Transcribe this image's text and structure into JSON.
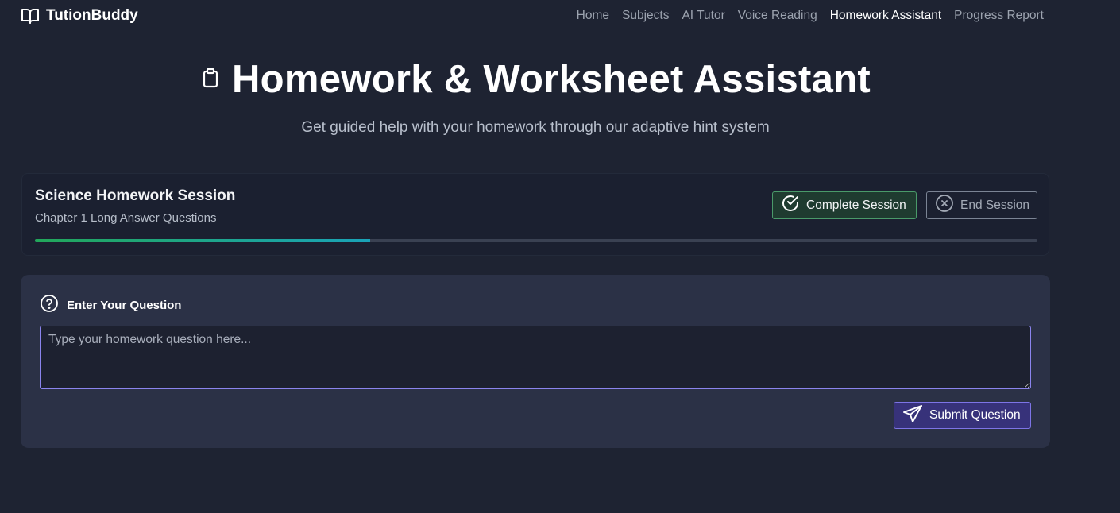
{
  "colors": {
    "background": "#1e2332",
    "card": "#2b3146",
    "accent": "#7d74e6",
    "success": "#4a9a6a"
  },
  "nav": {
    "brand": "TutionBuddy",
    "brand_icon": "open-book-icon",
    "links": [
      {
        "label": "Home",
        "active": false
      },
      {
        "label": "Subjects",
        "active": false
      },
      {
        "label": "AI Tutor",
        "active": false
      },
      {
        "label": "Voice Reading",
        "active": false
      },
      {
        "label": "Homework Assistant",
        "active": true
      },
      {
        "label": "Progress Report",
        "active": false
      }
    ]
  },
  "hero": {
    "icon": "clipboard-icon",
    "title": "Homework & Worksheet Assistant",
    "subtitle": "Get guided help with your homework through our adaptive hint system"
  },
  "session": {
    "title": "Science Homework Session",
    "subtitle": "Chapter 1 Long Answer Questions",
    "progress_percent": 33.4,
    "complete_button": "Complete Session",
    "complete_icon": "check-circle-icon",
    "end_button": "End Session",
    "end_icon": "x-circle-icon"
  },
  "question": {
    "icon": "question-circle-icon",
    "heading": "Enter Your Question",
    "placeholder": "Type your homework question here...",
    "value": "",
    "submit_button": "Submit Question",
    "submit_icon": "send-icon"
  }
}
